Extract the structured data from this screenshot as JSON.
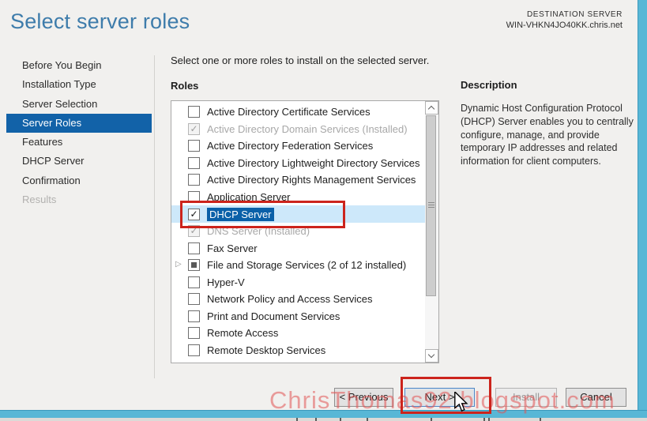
{
  "header": {
    "title": "Select server roles",
    "destination_label": "DESTINATION SERVER",
    "destination_server": "WIN-VHKN4JO40KK.chris.net"
  },
  "sidebar": {
    "items": [
      {
        "label": "Before You Begin",
        "state": "normal"
      },
      {
        "label": "Installation Type",
        "state": "normal"
      },
      {
        "label": "Server Selection",
        "state": "normal"
      },
      {
        "label": "Server Roles",
        "state": "selected"
      },
      {
        "label": "Features",
        "state": "normal"
      },
      {
        "label": "DHCP Server",
        "state": "normal"
      },
      {
        "label": "Confirmation",
        "state": "normal"
      },
      {
        "label": "Results",
        "state": "disabled"
      }
    ]
  },
  "main": {
    "instruction": "Select one or more roles to install on the selected server.",
    "roles_label": "Roles",
    "roles": [
      {
        "label": "Active Directory Certificate Services",
        "checkbox": "unchecked"
      },
      {
        "label": "Active Directory Domain Services (Installed)",
        "checkbox": "installed"
      },
      {
        "label": "Active Directory Federation Services",
        "checkbox": "unchecked"
      },
      {
        "label": "Active Directory Lightweight Directory Services",
        "checkbox": "unchecked"
      },
      {
        "label": "Active Directory Rights Management Services",
        "checkbox": "unchecked"
      },
      {
        "label": "Application Server",
        "checkbox": "unchecked"
      },
      {
        "label": "DHCP Server",
        "checkbox": "checked",
        "selected": true,
        "annotated": true
      },
      {
        "label": "DNS Server (Installed)",
        "checkbox": "installed"
      },
      {
        "label": "Fax Server",
        "checkbox": "unchecked"
      },
      {
        "label": "File and Storage Services (2 of 12 installed)",
        "checkbox": "partial",
        "expandable": true
      },
      {
        "label": "Hyper-V",
        "checkbox": "unchecked"
      },
      {
        "label": "Network Policy and Access Services",
        "checkbox": "unchecked"
      },
      {
        "label": "Print and Document Services",
        "checkbox": "unchecked"
      },
      {
        "label": "Remote Access",
        "checkbox": "unchecked"
      },
      {
        "label": "Remote Desktop Services",
        "checkbox": "unchecked"
      }
    ]
  },
  "description": {
    "title": "Description",
    "body": "Dynamic Host Configuration Protocol (DHCP) Server enables you to centrally configure, manage, and provide temporary IP addresses and related information for client computers."
  },
  "footer": {
    "previous_label": "< Previous",
    "next_label": "Next >",
    "install_label": "Install",
    "cancel_label": "Cancel"
  },
  "watermark": "ChrisThomas92.blogspot.com",
  "colors": {
    "accent_blue": "#1262a8",
    "title_blue": "#3e7cab",
    "selection_blue": "#0a60a8",
    "row_highlight_blue": "#cde8fa",
    "annotation_red": "#cc241c",
    "window_chrome_cyan": "#58b7d6"
  }
}
